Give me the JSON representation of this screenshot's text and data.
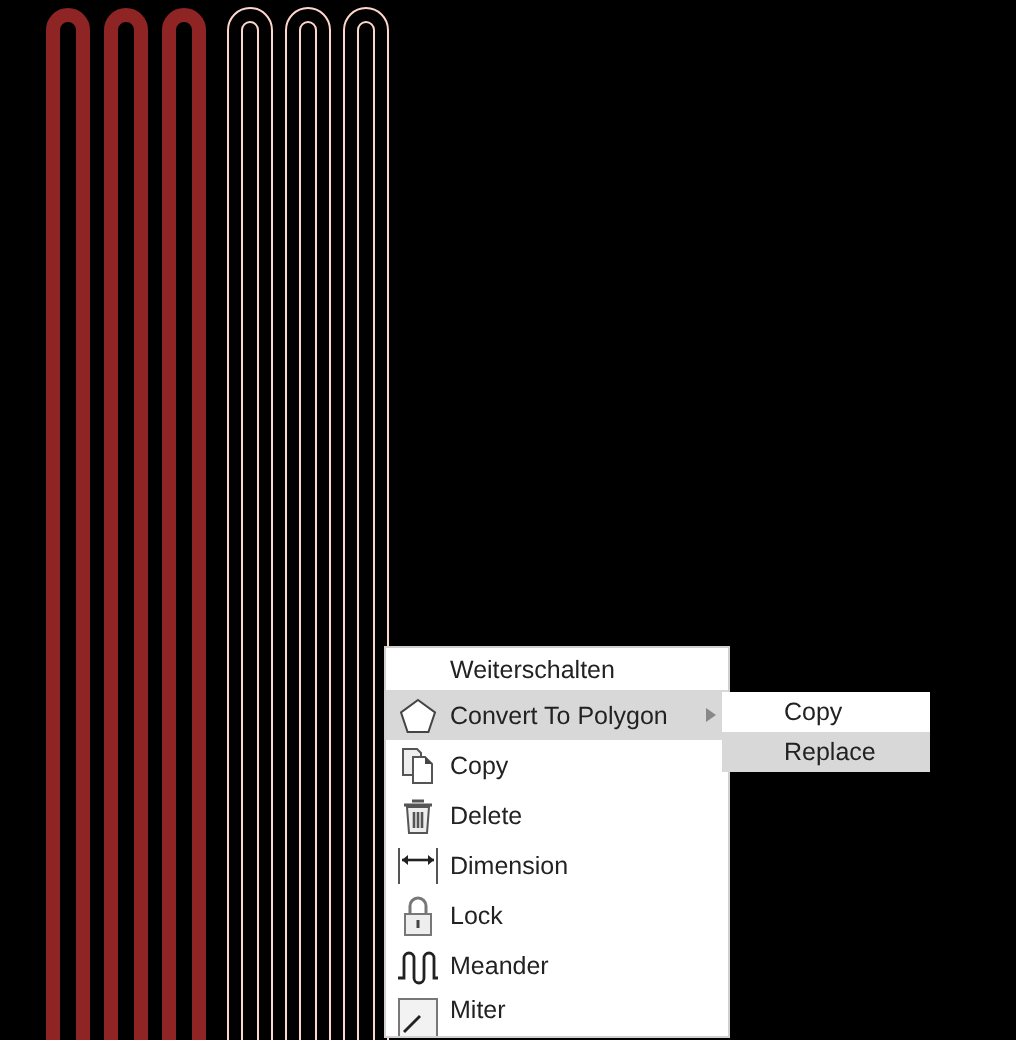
{
  "traces": [
    {
      "kind": "filled"
    },
    {
      "kind": "filled"
    },
    {
      "kind": "filled"
    },
    {
      "kind": "outline"
    },
    {
      "kind": "outline"
    },
    {
      "kind": "outline"
    }
  ],
  "context_menu": {
    "items": [
      {
        "label": "Weiterschalten",
        "selected": false,
        "submenu": false
      },
      {
        "label": "Convert To Polygon",
        "selected": true,
        "submenu": true
      },
      {
        "label": "Copy",
        "selected": false,
        "submenu": false
      },
      {
        "label": "Delete",
        "selected": false,
        "submenu": false
      },
      {
        "label": "Dimension",
        "selected": false,
        "submenu": false
      },
      {
        "label": "Lock",
        "selected": false,
        "submenu": false
      },
      {
        "label": "Meander",
        "selected": false,
        "submenu": false
      },
      {
        "label": "Miter",
        "selected": false,
        "submenu": false
      }
    ],
    "submenu": [
      {
        "label": "Copy",
        "selected": false
      },
      {
        "label": "Replace",
        "selected": true
      }
    ]
  }
}
